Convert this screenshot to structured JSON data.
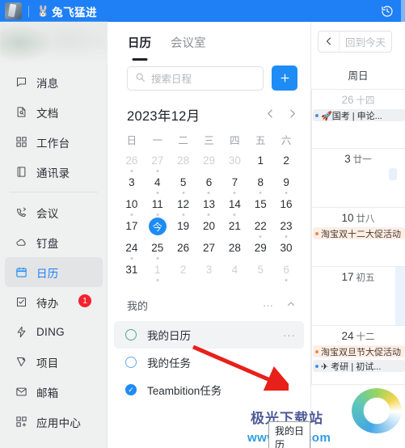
{
  "titlebar": {
    "emoji": "🐰",
    "title": "兔飞猛进",
    "history_icon": "history-clock-icon"
  },
  "sidebar": {
    "items": [
      {
        "label": "消息",
        "icon": "chat-bubble-icon",
        "active": false,
        "badge": ""
      },
      {
        "label": "文档",
        "icon": "document-icon",
        "active": false,
        "badge": ""
      },
      {
        "label": "工作台",
        "icon": "grid-apps-icon",
        "active": false,
        "badge": ""
      },
      {
        "label": "通讯录",
        "icon": "contacts-book-icon",
        "active": false,
        "badge": ""
      },
      {
        "label": "会议",
        "icon": "video-call-icon",
        "active": false,
        "badge": ""
      },
      {
        "label": "钉盘",
        "icon": "cloud-disk-icon",
        "active": false,
        "badge": ""
      },
      {
        "label": "日历",
        "icon": "calendar-icon",
        "active": true,
        "badge": ""
      },
      {
        "label": "待办",
        "icon": "checklist-icon",
        "active": false,
        "badge": "1"
      },
      {
        "label": "DING",
        "icon": "lightning-icon",
        "active": false,
        "badge": ""
      },
      {
        "label": "项目",
        "icon": "project-icon",
        "active": false,
        "badge": ""
      },
      {
        "label": "邮箱",
        "icon": "mail-envelope-icon",
        "active": false,
        "badge": ""
      },
      {
        "label": "应用中心",
        "icon": "add-apps-icon",
        "active": false,
        "badge": ""
      }
    ]
  },
  "calendar_panel": {
    "tabs": [
      {
        "label": "日历",
        "active": true
      },
      {
        "label": "会议室",
        "active": false
      }
    ],
    "search": {
      "placeholder": "搜索日程",
      "value": "",
      "icon": "search-icon"
    },
    "add_button": {
      "label": "+",
      "icon": "plus-icon"
    },
    "month_label": "2023年12月",
    "prev_icon": "chevron-left-icon",
    "next_icon": "chevron-right-icon",
    "weekday_headers": [
      "日",
      "一",
      "二",
      "三",
      "四",
      "五",
      "六"
    ],
    "today_label": "今",
    "days": [
      {
        "n": "26",
        "muted": true,
        "dot": true
      },
      {
        "n": "27",
        "muted": true,
        "dot": true
      },
      {
        "n": "28",
        "muted": true,
        "dot": false
      },
      {
        "n": "29",
        "muted": true,
        "dot": false
      },
      {
        "n": "30",
        "muted": true,
        "dot": false
      },
      {
        "n": "1",
        "muted": false,
        "dot": false
      },
      {
        "n": "2",
        "muted": false,
        "dot": false
      },
      {
        "n": "3",
        "muted": false,
        "dot": false
      },
      {
        "n": "4",
        "muted": false,
        "dot": true
      },
      {
        "n": "5",
        "muted": false,
        "dot": true
      },
      {
        "n": "6",
        "muted": false,
        "dot": true
      },
      {
        "n": "7",
        "muted": false,
        "dot": true
      },
      {
        "n": "8",
        "muted": false,
        "dot": true
      },
      {
        "n": "9",
        "muted": false,
        "dot": true
      },
      {
        "n": "10",
        "muted": false,
        "dot": true
      },
      {
        "n": "11",
        "muted": false,
        "dot": true
      },
      {
        "n": "12",
        "muted": false,
        "dot": true
      },
      {
        "n": "13",
        "muted": false,
        "dot": true
      },
      {
        "n": "14",
        "muted": false,
        "dot": true
      },
      {
        "n": "15",
        "muted": false,
        "dot": false
      },
      {
        "n": "16",
        "muted": false,
        "dot": false
      },
      {
        "n": "17",
        "muted": false,
        "dot": false
      },
      {
        "n": "18",
        "muted": false,
        "dot": false,
        "today": true
      },
      {
        "n": "19",
        "muted": false,
        "dot": false
      },
      {
        "n": "20",
        "muted": false,
        "dot": false
      },
      {
        "n": "21",
        "muted": false,
        "dot": false
      },
      {
        "n": "22",
        "muted": false,
        "dot": true
      },
      {
        "n": "23",
        "muted": false,
        "dot": true
      },
      {
        "n": "24",
        "muted": false,
        "dot": true
      },
      {
        "n": "25",
        "muted": false,
        "dot": true
      },
      {
        "n": "26",
        "muted": false,
        "dot": false
      },
      {
        "n": "27",
        "muted": false,
        "dot": false
      },
      {
        "n": "28",
        "muted": false,
        "dot": false
      },
      {
        "n": "29",
        "muted": false,
        "dot": false
      },
      {
        "n": "30",
        "muted": false,
        "dot": false
      },
      {
        "n": "31",
        "muted": false,
        "dot": false
      },
      {
        "n": "1",
        "muted": true,
        "dot": true
      },
      {
        "n": "2",
        "muted": true,
        "dot": false
      },
      {
        "n": "3",
        "muted": true,
        "dot": false
      },
      {
        "n": "4",
        "muted": true,
        "dot": false
      },
      {
        "n": "5",
        "muted": true,
        "dot": false
      },
      {
        "n": "6",
        "muted": true,
        "dot": true
      }
    ],
    "my_section": {
      "title": "我的",
      "more_icon": "ellipsis-icon",
      "collapse_icon": "chevron-up-icon",
      "items": [
        {
          "name": "我的日历",
          "color": "#4caf78",
          "state": "ring",
          "hover": true,
          "more": "···"
        },
        {
          "name": "我的任务",
          "color": "#6aa7f0",
          "state": "ring",
          "hover": false,
          "more": ""
        },
        {
          "name": "Teambition任务",
          "color": "#1f8cf5",
          "state": "checked",
          "hover": false,
          "more": ""
        }
      ]
    },
    "tooltip": "我的日历"
  },
  "schedule_panel": {
    "back_icon": "chevron-left-icon",
    "today_button": "回到今天",
    "weekday_header": "周日",
    "weeks": [
      {
        "day": "26",
        "lunar": "十四",
        "muted": true,
        "events": [
          {
            "text": "🚀国考 | 申论...",
            "style": "grey"
          }
        ]
      },
      {
        "day": "3",
        "lunar": "廿一",
        "muted": false,
        "events": [
          {
            "text": "",
            "style": "chipb"
          }
        ]
      },
      {
        "day": "10",
        "lunar": "廿八",
        "muted": false,
        "events": [
          {
            "text": "淘宝双十二大促活动",
            "style": "orange"
          }
        ]
      },
      {
        "day": "17",
        "lunar": "初五",
        "muted": false,
        "events": []
      },
      {
        "day": "24",
        "lunar": "十二",
        "muted": false,
        "events": [
          {
            "text": "淘宝双旦节大促活动",
            "style": "orange"
          },
          {
            "text": "✈ 考研 | 初试...",
            "style": "grey"
          }
        ]
      }
    ]
  },
  "watermark": {
    "text": "极光下载站",
    "url": "www.xz7.com",
    "logo": "swirl-logo"
  }
}
